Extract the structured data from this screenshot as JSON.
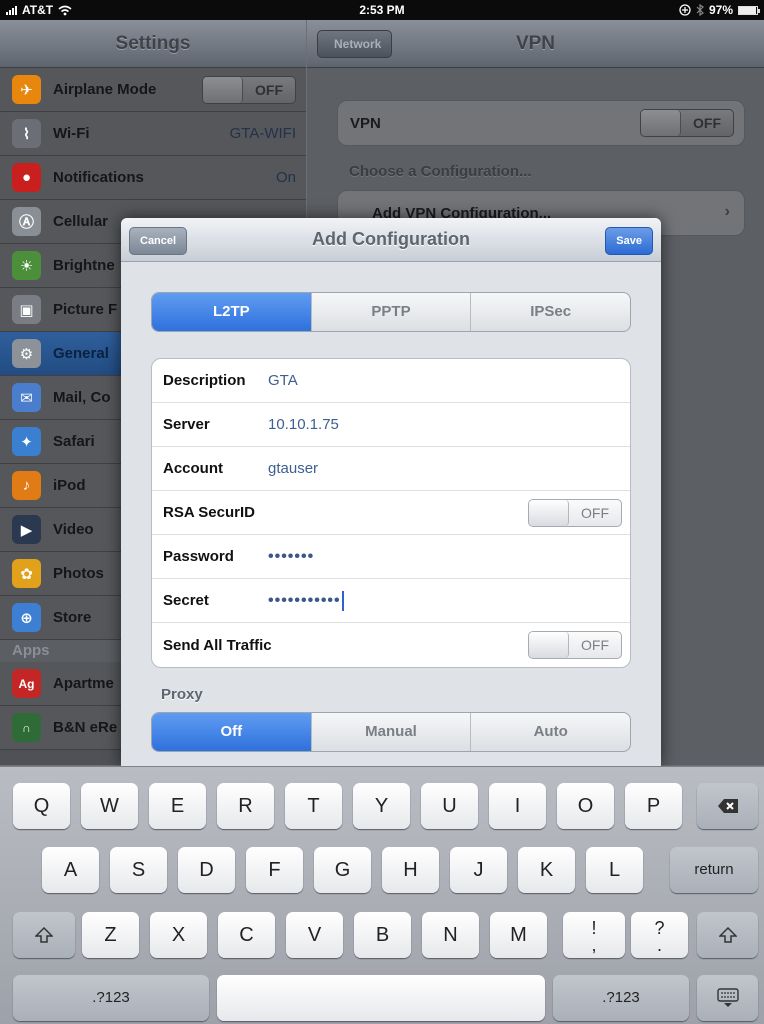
{
  "status_bar": {
    "carrier": "AT&T",
    "time": "2:53 PM",
    "battery": "97%",
    "battery_level": 0.97
  },
  "master": {
    "title": "Settings",
    "items": [
      {
        "label": "Airplane Mode",
        "toggle": "OFF",
        "icon": "airplane-icon",
        "color": "#e8870e"
      },
      {
        "label": "Wi-Fi",
        "value": "GTA-WIFI",
        "icon": "wifi-icon",
        "color": "#6b6f75"
      },
      {
        "label": "Notifications",
        "value": "On",
        "icon": "notifications-icon",
        "color": "#c9201f"
      },
      {
        "label": "Cellular",
        "icon": "cellular-icon",
        "color": "#8a8f96"
      },
      {
        "label": "Brightne",
        "icon": "brightness-icon",
        "color": "#4b8f3a"
      },
      {
        "label": "Picture F",
        "icon": "picture-frame-icon",
        "color": "#7a7e84"
      },
      {
        "label": "General",
        "icon": "gear-icon",
        "color": "#8d9298",
        "selected": true
      },
      {
        "label": "Mail, Co",
        "icon": "mail-icon",
        "color": "#4a7ecc"
      },
      {
        "label": "Safari",
        "icon": "safari-icon",
        "color": "#3a7fd0"
      },
      {
        "label": "iPod",
        "icon": "ipod-icon",
        "color": "#e07b15"
      },
      {
        "label": "Video",
        "icon": "video-icon",
        "color": "#2a3850"
      },
      {
        "label": "Photos",
        "icon": "photos-icon",
        "color": "#e2a11a"
      },
      {
        "label": "Store",
        "icon": "store-icon",
        "color": "#3d7fd2"
      }
    ],
    "apps_header": "Apps",
    "apps": [
      {
        "label": "Apartme",
        "icon_text": "Ag",
        "icon": "apartments-app-icon",
        "color": "#c42626"
      },
      {
        "label": "B&N eRe",
        "icon": "bn-ereader-icon",
        "color": "#2e6b36"
      }
    ]
  },
  "detail": {
    "back": "Network",
    "title": "VPN",
    "vpn_label": "VPN",
    "vpn_toggle": "OFF",
    "choose_label": "Choose a Configuration...",
    "add_config": "Add VPN Configuration..."
  },
  "sheet": {
    "cancel": "Cancel",
    "title": "Add Configuration",
    "save": "Save",
    "types": [
      "L2TP",
      "PPTP",
      "IPSec"
    ],
    "selected_type": "L2TP",
    "fields": {
      "description_label": "Description",
      "description_value": "GTA",
      "server_label": "Server",
      "server_value": "10.10.1.75",
      "account_label": "Account",
      "account_value": "gtauser",
      "rsa_label": "RSA SecurID",
      "rsa_toggle": "OFF",
      "password_label": "Password",
      "password_value": "•••••••",
      "secret_label": "Secret",
      "secret_value": "•••••••••••",
      "send_all_label": "Send All Traffic",
      "send_all_toggle": "OFF"
    },
    "proxy_label": "Proxy",
    "proxy_options": [
      "Off",
      "Manual",
      "Auto"
    ],
    "proxy_selected": "Off"
  },
  "keyboard": {
    "row1": [
      "Q",
      "W",
      "E",
      "R",
      "T",
      "Y",
      "U",
      "I",
      "O",
      "P"
    ],
    "row2": [
      "A",
      "S",
      "D",
      "F",
      "G",
      "H",
      "J",
      "K",
      "L"
    ],
    "row3": [
      "Z",
      "X",
      "C",
      "V",
      "B",
      "N",
      "M"
    ],
    "return": "return",
    "numbers": ".?123",
    "punct_excl_top": "!",
    "punct_excl_bottom": ",",
    "punct_q_top": "?",
    "punct_q_bottom": ".",
    "icons": [
      "backspace-icon",
      "shift-icon",
      "hide-keyboard-icon"
    ]
  }
}
